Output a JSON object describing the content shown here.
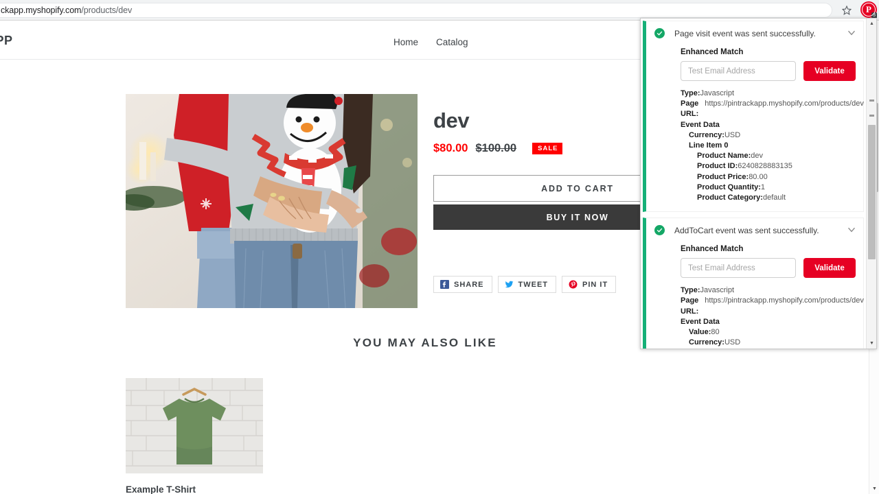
{
  "browser": {
    "url_text": "ckapp.myshopify.com",
    "url_path": "/products/dev",
    "star_icon": "bookmark-star-icon",
    "extension_icon": "pinterest-extension-icon",
    "extension_badge": "3"
  },
  "site": {
    "logo": "APP",
    "nav": [
      {
        "label": "Home"
      },
      {
        "label": "Catalog"
      }
    ]
  },
  "product": {
    "title": "dev",
    "price_sale": "$80.00",
    "price_compare": "$100.00",
    "sale_badge": "SALE",
    "add_to_cart": "ADD TO CART",
    "buy_it_now": "BUY IT NOW",
    "share": [
      {
        "label": "SHARE",
        "icon": "facebook-icon",
        "color": "#3b5998"
      },
      {
        "label": "TWEET",
        "icon": "twitter-icon",
        "color": "#1da1f2"
      },
      {
        "label": "PIN IT",
        "icon": "pinterest-icon",
        "color": "#e60023"
      }
    ]
  },
  "recommendations": {
    "heading": "YOU MAY ALSO LIKE",
    "items": [
      {
        "name": "Example T-Shirt"
      }
    ]
  },
  "extension_panel": {
    "events": [
      {
        "status_icon": "check-circle-icon",
        "status_color": "#14a766",
        "message": "Page visit event was sent successfully.",
        "collapse_icon": "chevron-down-icon",
        "enhanced_match_label": "Enhanced Match",
        "email_placeholder": "Test Email Address",
        "email_value": "",
        "validate_label": "Validate",
        "type_label": "Type:",
        "type_value": "Javascript",
        "page_label": "Page",
        "page_value": "https://pintrackapp.myshopify.com/products/dev",
        "url_label": "URL:",
        "url_value": "",
        "event_data_label": "Event Data",
        "fields": [
          {
            "label": "Currency:",
            "value": "USD",
            "indent": 1
          },
          {
            "label": "Line Item 0",
            "value": "",
            "indent": 1
          },
          {
            "label": "Product Name:",
            "value": "dev",
            "indent": 2
          },
          {
            "label": "Product ID:",
            "value": "6240828883135",
            "indent": 2
          },
          {
            "label": "Product Price:",
            "value": "80.00",
            "indent": 2
          },
          {
            "label": "Product Quantity:",
            "value": "1",
            "indent": 2
          },
          {
            "label": "Product Category:",
            "value": "default",
            "indent": 2
          }
        ]
      },
      {
        "status_icon": "check-circle-icon",
        "status_color": "#14a766",
        "message": "AddToCart event was sent successfully.",
        "collapse_icon": "chevron-down-icon",
        "enhanced_match_label": "Enhanced Match",
        "email_placeholder": "Test Email Address",
        "email_value": "",
        "validate_label": "Validate",
        "type_label": "Type:",
        "type_value": "Javascript",
        "page_label": "Page",
        "page_value": "https://pintrackapp.myshopify.com/products/dev",
        "url_label": "URL:",
        "url_value": "",
        "event_data_label": "Event Data",
        "fields": [
          {
            "label": "Value:",
            "value": "80",
            "indent": 1
          },
          {
            "label": "Currency:",
            "value": "USD",
            "indent": 1
          }
        ]
      }
    ]
  },
  "colors": {
    "accent_green": "#14a766",
    "brand_red": "#e60023",
    "sale_red": "#ff0000",
    "dark_button": "#3a3a3a"
  }
}
